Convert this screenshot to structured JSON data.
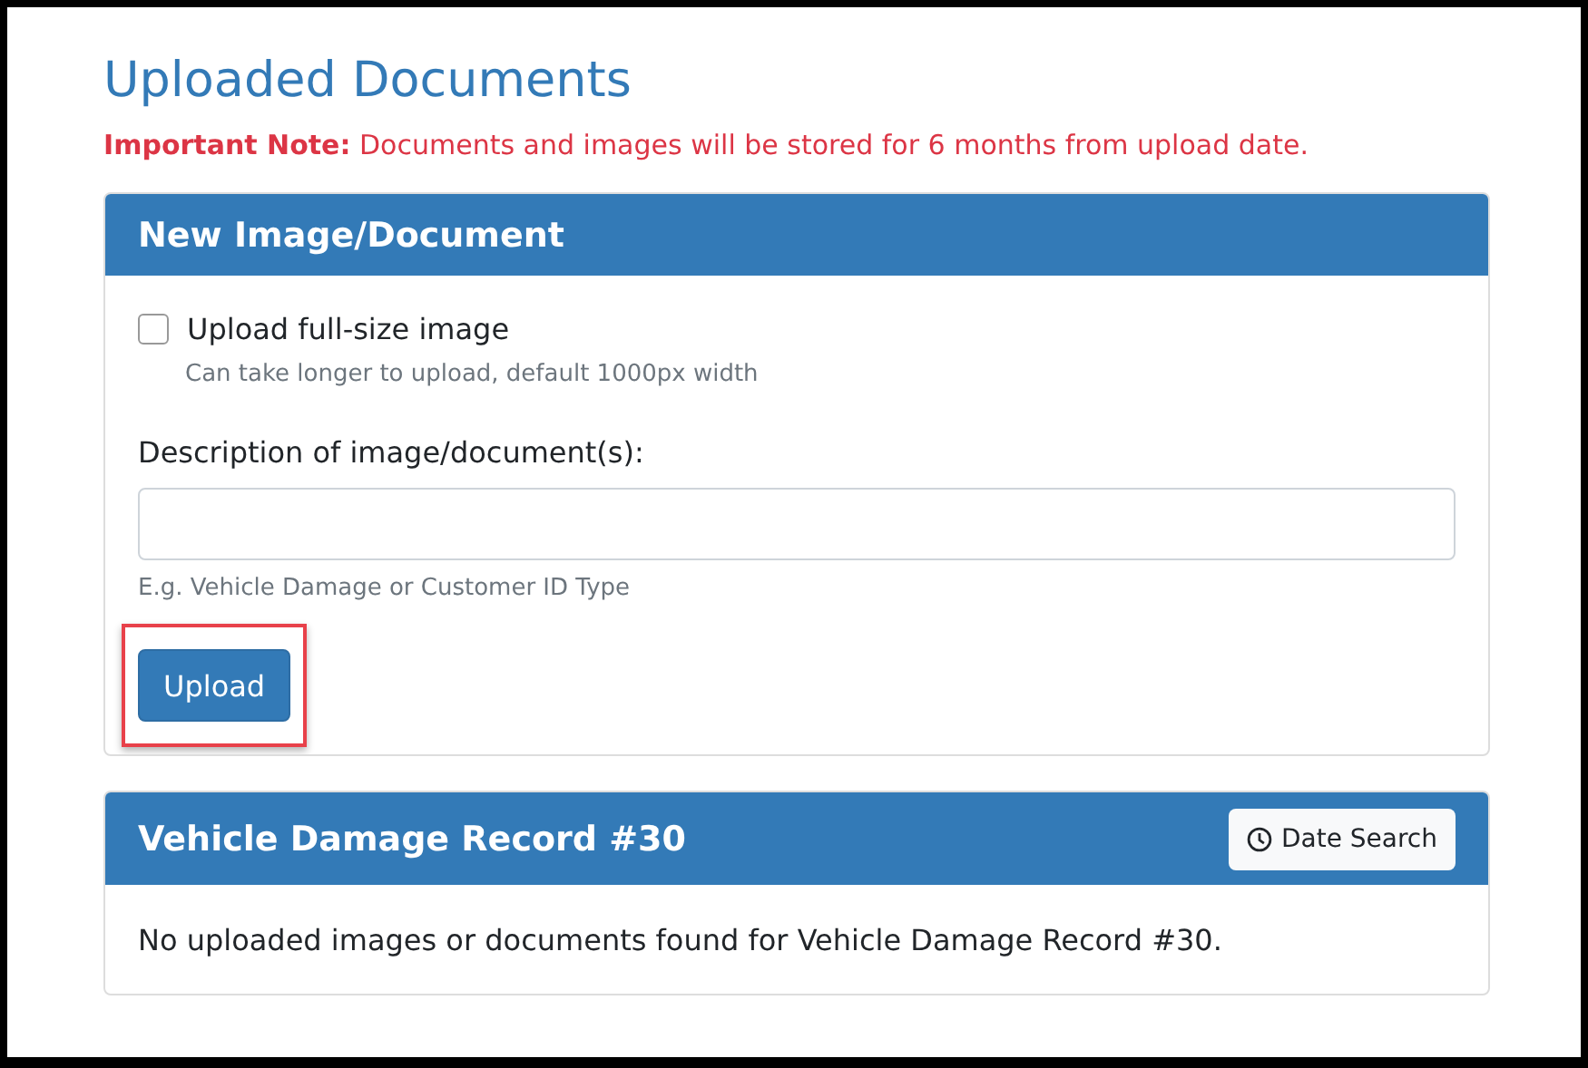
{
  "title": "Uploaded Documents",
  "note": {
    "label": "Important Note:",
    "text": "Documents and images will be stored for 6 months from upload date."
  },
  "upload_card": {
    "title": "New Image/Document",
    "checkbox": {
      "label": "Upload full-size image",
      "checked": false,
      "help": "Can take longer to upload, default 1000px width"
    },
    "description": {
      "label": "Description of image/document(s):",
      "help": "E.g. Vehicle Damage or Customer ID Type"
    },
    "button": {
      "label": "Upload",
      "highlighted": true
    }
  },
  "record_card": {
    "title": "Vehicle Damage Record #30",
    "button": {
      "label": "Date Search"
    },
    "message": "No uploaded images or documents found for Vehicle Damage Record #30."
  }
}
